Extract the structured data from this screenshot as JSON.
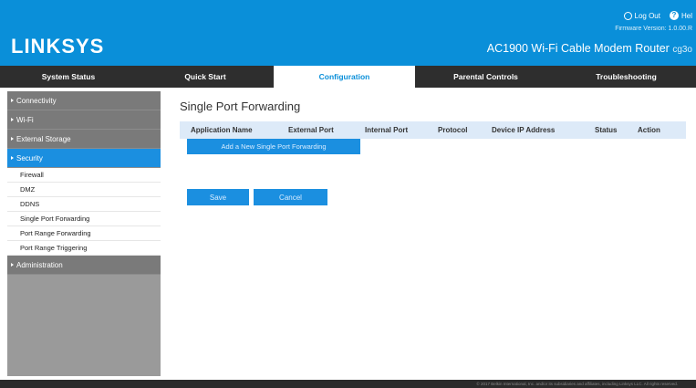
{
  "header": {
    "logo": "LINKSYS",
    "logout_label": "Log Out",
    "help_label": "Hel",
    "firmware": "Firmware Version: 1.0.00.R",
    "product_name": "AC1900 Wi-Fi Cable Modem Router",
    "model": "cg3o"
  },
  "tabs": [
    {
      "label": "System Status"
    },
    {
      "label": "Quick Start"
    },
    {
      "label": "Configuration",
      "active": true
    },
    {
      "label": "Parental Controls"
    },
    {
      "label": "Troubleshooting"
    }
  ],
  "sidebar": {
    "sections": [
      {
        "label": "Connectivity"
      },
      {
        "label": "Wi-Fi"
      },
      {
        "label": "External Storage"
      },
      {
        "label": "Security",
        "active": true
      },
      {
        "label": "Administration"
      }
    ],
    "security_items": [
      {
        "label": "Firewall"
      },
      {
        "label": "DMZ"
      },
      {
        "label": "DDNS"
      },
      {
        "label": "Single Port Forwarding"
      },
      {
        "label": "Port Range Forwarding"
      },
      {
        "label": "Port Range Triggering"
      }
    ]
  },
  "main": {
    "title": "Single Port Forwarding",
    "columns": [
      "Application Name",
      "External Port",
      "Internal Port",
      "Protocol",
      "Device IP Address",
      "Status",
      "Action"
    ],
    "add_button": "Add a New Single Port Forwarding",
    "save_button": "Save",
    "cancel_button": "Cancel"
  },
  "footer": {
    "text": "© 2017 Belkin International, Inc. and/or its subsidiaries and affiliates, including Linksys LLC. All rights reserved."
  },
  "colors": {
    "accent": "#0a8fd9",
    "active_blue": "#1b8fe0",
    "tab_bar": "#2e2e2e",
    "sidebar_dark": "#7a7a7a"
  }
}
